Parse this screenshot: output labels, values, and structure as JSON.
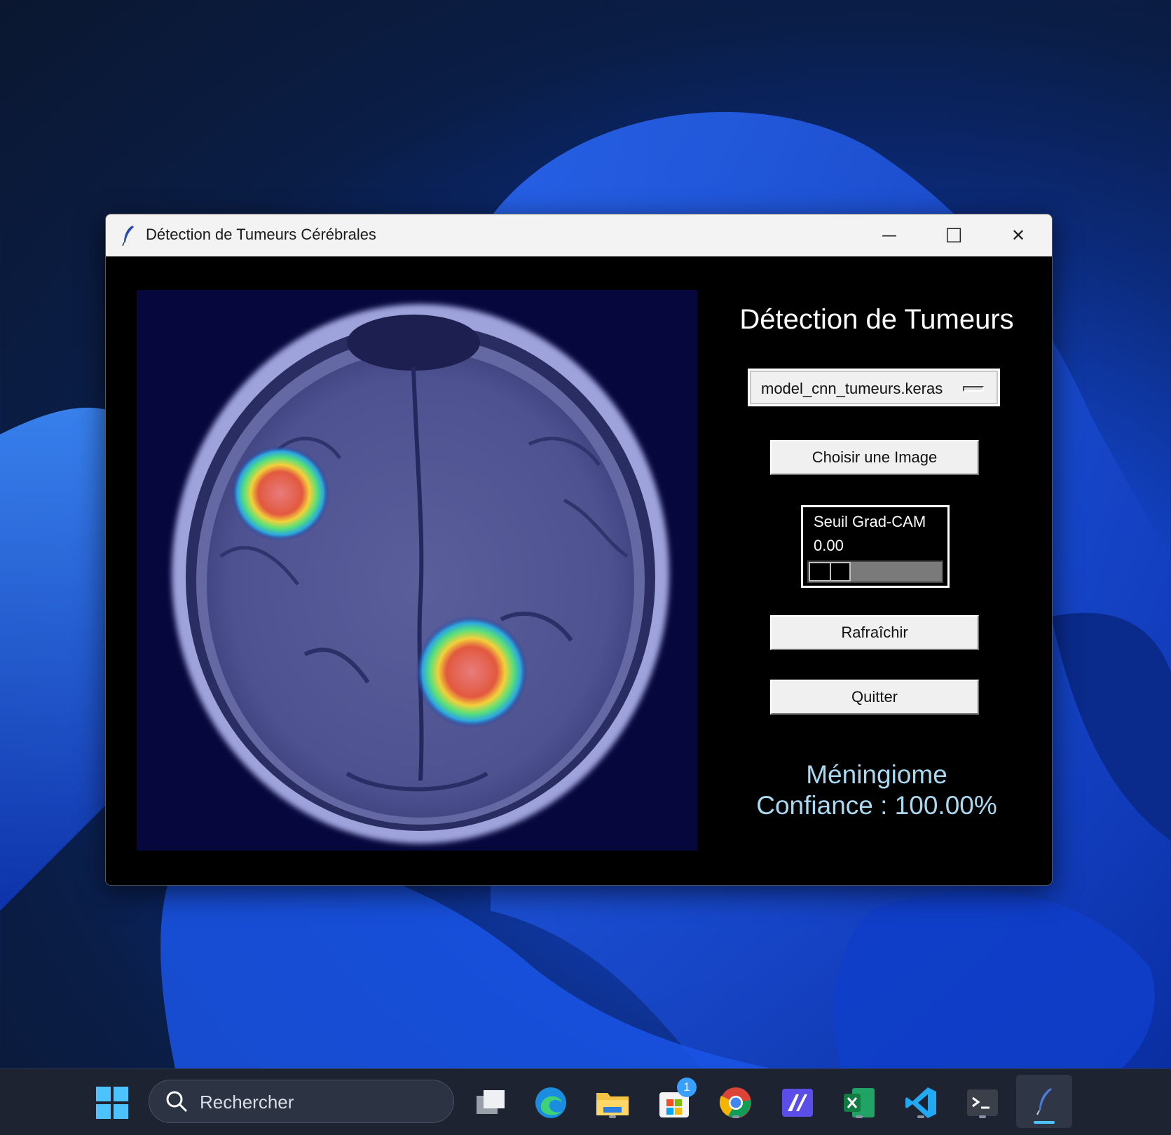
{
  "window": {
    "title": "Détection de Tumeurs Cérébrales",
    "minimize_glyph": "—",
    "maximize_glyph": "☐",
    "close_glyph": "✕"
  },
  "panel": {
    "heading": "Détection de Tumeurs",
    "model_select": {
      "selected": "model_cnn_tumeurs.keras"
    },
    "choose_image_label": "Choisir une Image",
    "threshold": {
      "label": "Seuil Grad-CAM",
      "value_text": "0.00",
      "value": 0.0
    },
    "refresh_label": "Rafraîchir",
    "quit_label": "Quitter",
    "result": {
      "class_label": "Méningiome",
      "confidence_text": "Confiance : 100.00%"
    }
  },
  "taskbar": {
    "search_placeholder": "Rechercher",
    "store_badge": "1",
    "items": [
      "start-icon",
      "search-icon",
      "task-view-icon",
      "edge-icon",
      "file-explorer-icon",
      "store-icon",
      "chrome-icon",
      "app-icon",
      "excel-icon",
      "vscode-icon",
      "terminal-icon",
      "python-tk-icon"
    ]
  },
  "colors": {
    "window_bg": "#000000",
    "result_text": "#a9d9f0",
    "mri_tint": "#8f93d6"
  }
}
